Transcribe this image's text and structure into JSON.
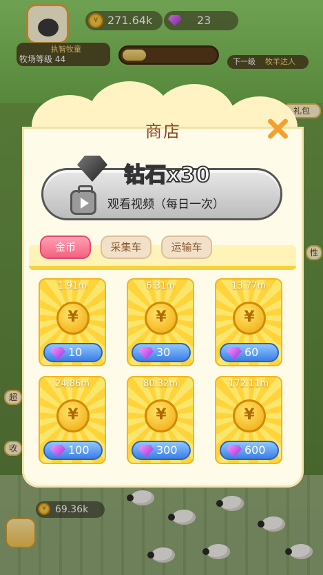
{
  "hud": {
    "coins": "271.64k",
    "gems": "23",
    "player_title": "执智牧童",
    "ranch_level_label": "牧场等级",
    "ranch_level": "44",
    "ranch_progress": 0.25,
    "next_label": "下一级",
    "next_title": "牧羊达人",
    "side_labels": [
      "超",
      "收",
      "礼包",
      "性"
    ],
    "bottom_coins": "69.36k"
  },
  "shop": {
    "title": "商店",
    "promo": {
      "title": "钻石x30",
      "subtitle": "观看视频（每日一次）"
    },
    "tabs": [
      {
        "label": "金币",
        "active": true
      },
      {
        "label": "采集车",
        "active": false
      },
      {
        "label": "运输车",
        "active": false
      }
    ],
    "coin_symbol": "¥",
    "items": [
      {
        "amount": "1.91m",
        "price": "10"
      },
      {
        "amount": "6.31m",
        "price": "30"
      },
      {
        "amount": "13.77m",
        "price": "60"
      },
      {
        "amount": "24.86m",
        "price": "100"
      },
      {
        "amount": "80.32m",
        "price": "300"
      },
      {
        "amount": "172.11m",
        "price": "600"
      }
    ]
  },
  "colors": {
    "accent_pink": "#f3627f",
    "coin_gold": "#ffd43a",
    "price_blue": "#3b7fe6",
    "close_orange": "#f3a02e"
  }
}
